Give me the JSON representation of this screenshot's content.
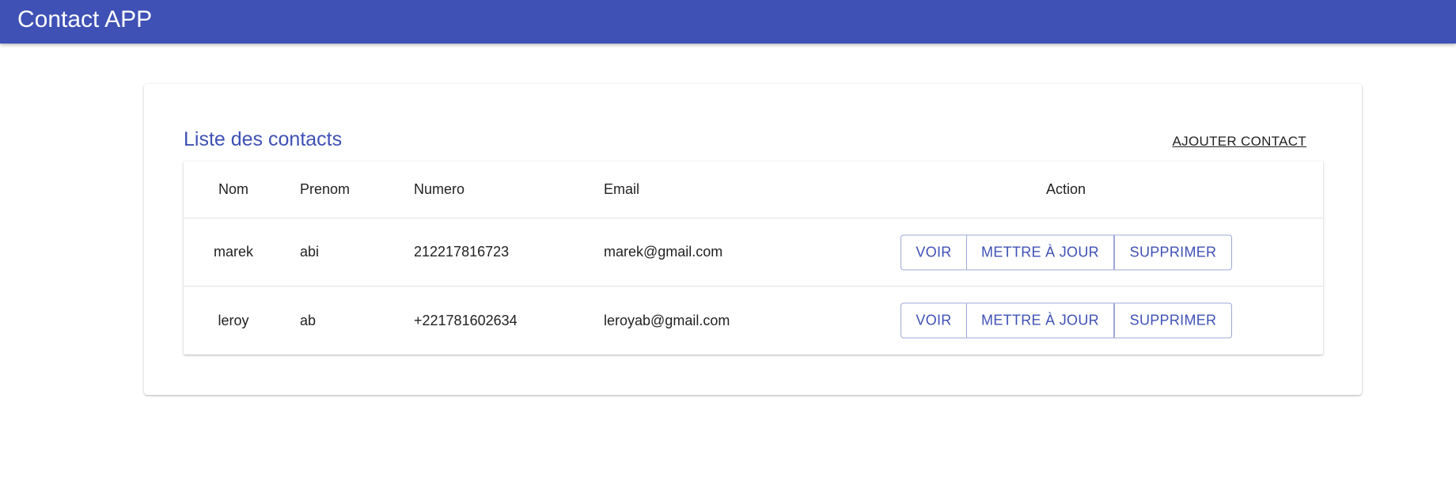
{
  "app": {
    "title": "Contact APP"
  },
  "card": {
    "title": "Liste des contacts",
    "add_label": "AJOUTER CONTACT"
  },
  "table": {
    "headers": {
      "nom": "Nom",
      "prenom": "Prenom",
      "numero": "Numero",
      "email": "Email",
      "action": "Action"
    },
    "rows": [
      {
        "nom": "marek",
        "prenom": "abi",
        "numero": "212217816723",
        "email": "marek@gmail.com",
        "actions": {
          "voir": "VOIR",
          "maj": "METTRE À JOUR",
          "supprimer": "SUPPRIMER"
        }
      },
      {
        "nom": "leroy",
        "prenom": "ab",
        "numero": "+221781602634",
        "email": "leroyab@gmail.com",
        "actions": {
          "voir": "VOIR",
          "maj": "METTRE À JOUR",
          "supprimer": "SUPPRIMER"
        }
      }
    ]
  },
  "colors": {
    "primary": "#3f51b5",
    "button_border": "#9fa8da"
  }
}
